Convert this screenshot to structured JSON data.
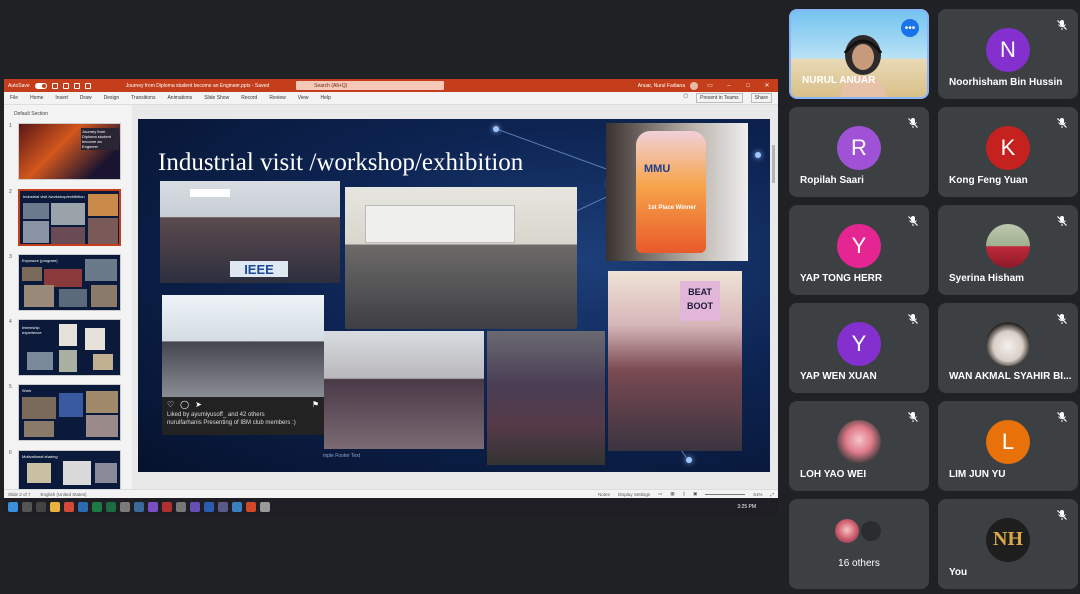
{
  "ppt": {
    "autosave": "AutoSave",
    "doc_title": "Journey from Diploma student become an Engineer.pptx - Saved",
    "search_placeholder": "Search (Alt+Q)",
    "user": "Anuar, Nurul Fadiana",
    "menu": [
      "File",
      "Home",
      "Insert",
      "Draw",
      "Design",
      "Transitions",
      "Animations",
      "Slide Show",
      "Record",
      "Review",
      "View",
      "Help"
    ],
    "present_teams": "Present in Teams",
    "share": "Share",
    "section": "Default Section",
    "thumb_titles": [
      "Journey from Diploma student become an Engineer",
      "Industrial visit /workshop/exhibition",
      "Exposure (program)",
      "Internship experience",
      "Work",
      "Motivational sharing"
    ],
    "slide": {
      "title": "Industrial visit /workshop/exhibition",
      "insta_liked": "Liked by ayumiyusoff_ and 42 others",
      "insta_caption": "nurulfarhanis Presenting of IBM club members :)",
      "trophy_brand": "MMU",
      "trophy_text": "1st Place Winner",
      "banner_text": "BEAT BOOT",
      "sign_text": "IEEE",
      "footer": "mple Footer Text"
    },
    "status": {
      "slide_of": "Slide 2 of 7",
      "language": "English (United States)",
      "notes": "Notes",
      "display": "Display Settings",
      "zoom": "51%"
    },
    "clock": "3:25 PM"
  },
  "participants": [
    {
      "name": "NURUL ANUAR",
      "video": true
    },
    {
      "name": "Noorhisham Bin Hussin",
      "initial": "N",
      "color": "#8430ce"
    },
    {
      "name": "Ropilah Saari",
      "initial": "R",
      "color": "#9f52d6"
    },
    {
      "name": "Kong Feng Yuan",
      "initial": "K",
      "color": "#c5221f"
    },
    {
      "name": "YAP TONG HERR",
      "initial": "Y",
      "color": "#e52592"
    },
    {
      "name": "Syerina Hisham",
      "photo": true
    },
    {
      "name": "YAP WEN XUAN",
      "initial": "Y",
      "color": "#8430ce"
    },
    {
      "name": "WAN AKMAL SYAHIR BI...",
      "photo": true
    },
    {
      "name": "LOH YAO WEI",
      "photo": true
    },
    {
      "name": "LIM JUN YU",
      "initial": "L",
      "color": "#e8710a"
    },
    {
      "name": "16 others"
    },
    {
      "name": "You",
      "initials_logo": "NH"
    }
  ],
  "icons": {
    "mute": "mic-off-icon",
    "more": "more-options-icon"
  }
}
